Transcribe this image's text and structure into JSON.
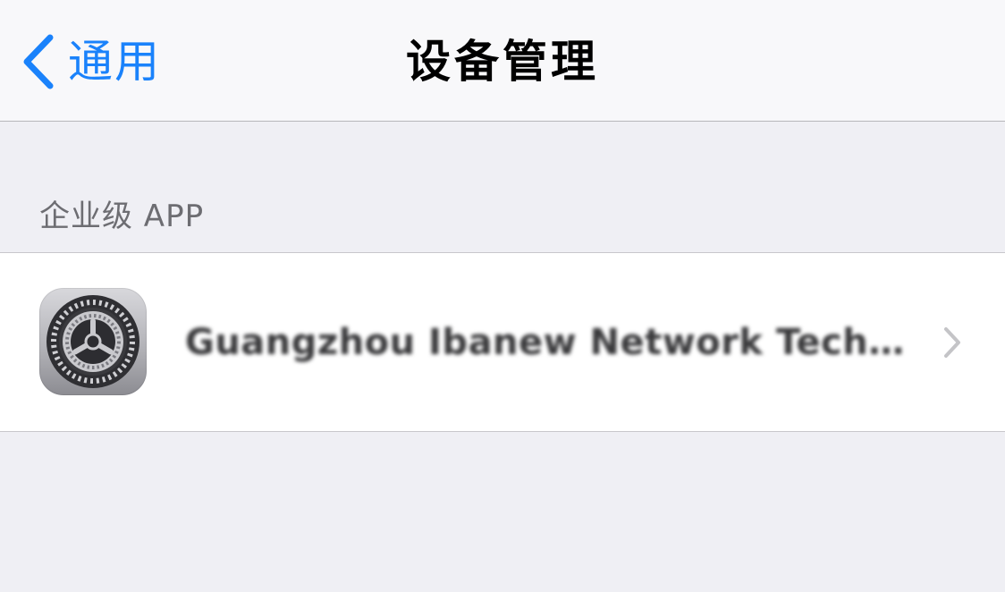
{
  "navbar": {
    "back_label": "通用",
    "title": "设备管理"
  },
  "section": {
    "header": "企业级 APP"
  },
  "profiles": [
    {
      "name": "Guangzhou Ibanew Network Technology Co., Ltd.",
      "icon": "settings-gear-icon"
    }
  ],
  "colors": {
    "accent": "#1a82fb",
    "background": "#efeff4",
    "navbar": "#f8f8fa",
    "section_text": "#6d6d72"
  }
}
